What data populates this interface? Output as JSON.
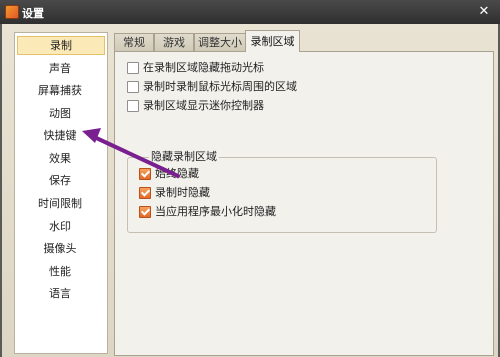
{
  "window": {
    "title": "设置",
    "close_glyph": "✕"
  },
  "sidebar": {
    "items": [
      {
        "label": "录制",
        "active": true
      },
      {
        "label": "声音"
      },
      {
        "label": "屏幕捕获"
      },
      {
        "label": "动图"
      },
      {
        "label": "快捷键"
      },
      {
        "label": "效果"
      },
      {
        "label": "保存"
      },
      {
        "label": "时间限制"
      },
      {
        "label": "水印"
      },
      {
        "label": "摄像头"
      },
      {
        "label": "性能"
      },
      {
        "label": "语言"
      }
    ]
  },
  "tabs": [
    {
      "label": "常规"
    },
    {
      "label": "游戏"
    },
    {
      "label": "调整大小"
    },
    {
      "label": "录制区域",
      "active": true
    }
  ],
  "options": [
    {
      "label": "在录制区域隐藏拖动光标",
      "checked": false
    },
    {
      "label": "录制时录制鼠标光标周围的区域",
      "checked": false
    },
    {
      "label": "录制区域显示迷你控制器",
      "checked": false
    }
  ],
  "hide_group": {
    "title": "隐藏录制区域",
    "options": [
      {
        "label": "始终隐藏",
        "checked": true
      },
      {
        "label": "录制时隐藏",
        "checked": true
      },
      {
        "label": "当应用程序最小化时隐藏",
        "checked": true
      }
    ]
  },
  "colors": {
    "accent_checkbox": "#e46a28",
    "annotation_arrow": "#7a1f8f",
    "active_sidebar": "#fbe9b8"
  },
  "annotation": {
    "icon": "arrow-annotation",
    "target": "快捷键"
  }
}
